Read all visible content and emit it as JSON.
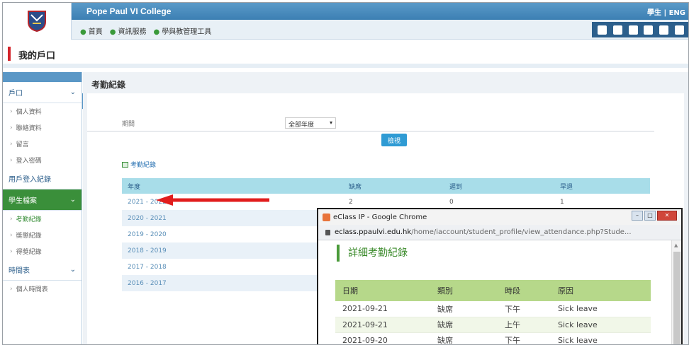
{
  "header": {
    "college_name": "Pope Paul VI College",
    "user_links": "學生 | ENG",
    "nav_items": [
      "首頁",
      "資訊服務",
      "學與教管理工具"
    ]
  },
  "portal": {
    "title": "我的戶口"
  },
  "sidebar": {
    "sections": [
      {
        "label": "戶口",
        "items": [
          "個人資料",
          "聯絡資料",
          "留言",
          "登入密碼"
        ]
      },
      {
        "label": "用戶登入紀錄",
        "items": []
      },
      {
        "label": "學生檔案",
        "items": [
          "考勤紀錄",
          "獎懲紀錄",
          "得獎紀錄"
        ]
      },
      {
        "label": "時間表",
        "items": [
          "個人時間表"
        ]
      }
    ]
  },
  "main": {
    "title": "考勤紀錄",
    "period_label": "期間",
    "period_value": "全部年度",
    "view_button": "檢視",
    "section_link": "考勤紀錄",
    "table": {
      "headers": [
        "年度",
        "缺席",
        "遲到",
        "早退"
      ],
      "rows": [
        [
          "2021 - 2022",
          "2",
          "0",
          "1"
        ],
        [
          "2020 - 2021",
          "",
          "",
          ""
        ],
        [
          "2019 - 2020",
          "",
          "",
          ""
        ],
        [
          "2018 - 2019",
          "",
          "",
          ""
        ],
        [
          "2017 - 2018",
          "",
          "",
          ""
        ],
        [
          "2016 - 2017",
          "",
          "",
          ""
        ]
      ]
    }
  },
  "popup": {
    "window_title": "eClass IP - Google Chrome",
    "url_host": "eclass.ppaulvi.edu.hk",
    "url_path": "/home/iaccount/student_profile/view_attendance.php?Stude...",
    "heading": "詳細考勤紀錄",
    "table": {
      "headers": [
        "日期",
        "類別",
        "時段",
        "原因"
      ],
      "rows": [
        [
          "2021-09-21",
          "缺席",
          "下午",
          "Sick leave"
        ],
        [
          "2021-09-21",
          "缺席",
          "上午",
          "Sick leave"
        ],
        [
          "2021-09-20",
          "缺席",
          "下午",
          "Sick leave"
        ]
      ]
    }
  },
  "colors": {
    "header_blue": "#3c7fb3",
    "accent_red": "#d3232a",
    "active_green": "#3a8f3a",
    "table_header": "#a8dde9",
    "popup_header": "#b6d88a",
    "arrow_red": "#e11d1d"
  }
}
